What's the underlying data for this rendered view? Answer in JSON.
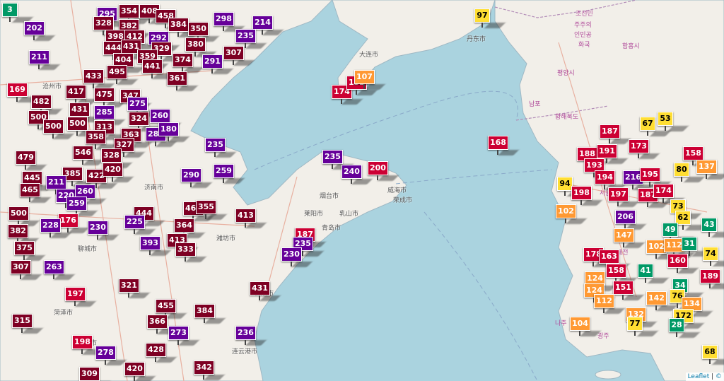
{
  "colors": {
    "sea": "#aad3df",
    "land": "#f2efe9",
    "good": "#009966",
    "moderate": "#ffde33",
    "sensitive": "#ff9933",
    "unhealthy": "#cc0033",
    "very_unhealthy": "#660099",
    "hazardous": "#7e0023"
  },
  "attribution": {
    "leaflet": "Leaflet",
    "separator": " | ",
    "copy": "©"
  },
  "places": [
    {
      "name": "조선민"
    },
    {
      "name": "주주의"
    },
    {
      "name": "인민공"
    },
    {
      "name": "화국"
    },
    {
      "name": "함흥시"
    },
    {
      "name": "평양시"
    },
    {
      "name": "남포"
    },
    {
      "name": "황해북도"
    },
    {
      "name": "서울"
    },
    {
      "name": "대전"
    },
    {
      "name": "광주"
    },
    {
      "name": "나주"
    },
    {
      "name": "丹东市"
    },
    {
      "name": "大连市"
    },
    {
      "name": "烟台市"
    },
    {
      "name": "威海市"
    },
    {
      "name": "青岛市"
    },
    {
      "name": "乳山市"
    },
    {
      "name": "莱阳市"
    },
    {
      "name": "荣成市"
    },
    {
      "name": "日照市"
    },
    {
      "name": "连云港市"
    },
    {
      "name": "济南市"
    },
    {
      "name": "潍坊市"
    },
    {
      "name": "沧州市"
    },
    {
      "name": "聊城市"
    },
    {
      "name": "商丘市"
    },
    {
      "name": "菏泽市"
    }
  ],
  "stations": [
    {
      "aqi": "3",
      "level": "good"
    },
    {
      "aqi": "202",
      "level": "very_unhealthy"
    },
    {
      "aqi": "295",
      "level": "very_unhealthy"
    },
    {
      "aqi": "354",
      "level": "hazardous"
    },
    {
      "aqi": "408",
      "level": "hazardous"
    },
    {
      "aqi": "458",
      "level": "hazardous"
    },
    {
      "aqi": "298",
      "level": "very_unhealthy"
    },
    {
      "aqi": "214",
      "level": "very_unhealthy"
    },
    {
      "aqi": "235",
      "level": "very_unhealthy"
    },
    {
      "aqi": "97",
      "level": "moderate"
    },
    {
      "aqi": "328",
      "level": "hazardous"
    },
    {
      "aqi": "382",
      "level": "hazardous"
    },
    {
      "aqi": "398",
      "level": "hazardous"
    },
    {
      "aqi": "412",
      "level": "hazardous"
    },
    {
      "aqi": "292",
      "level": "very_unhealthy"
    },
    {
      "aqi": "384",
      "level": "hazardous"
    },
    {
      "aqi": "350",
      "level": "hazardous"
    },
    {
      "aqi": "380",
      "level": "hazardous"
    },
    {
      "aqi": "307",
      "level": "hazardous"
    },
    {
      "aqi": "291",
      "level": "very_unhealthy"
    },
    {
      "aqi": "211",
      "level": "very_unhealthy"
    },
    {
      "aqi": "444",
      "level": "hazardous"
    },
    {
      "aqi": "431",
      "level": "hazardous"
    },
    {
      "aqi": "329",
      "level": "hazardous"
    },
    {
      "aqi": "404",
      "level": "hazardous"
    },
    {
      "aqi": "359",
      "level": "hazardous"
    },
    {
      "aqi": "495",
      "level": "hazardous"
    },
    {
      "aqi": "441",
      "level": "hazardous"
    },
    {
      "aqi": "374",
      "level": "hazardous"
    },
    {
      "aqi": "433",
      "level": "hazardous"
    },
    {
      "aqi": "361",
      "level": "hazardous"
    },
    {
      "aqi": "169",
      "level": "unhealthy"
    },
    {
      "aqi": "417",
      "level": "hazardous"
    },
    {
      "aqi": "475",
      "level": "hazardous"
    },
    {
      "aqi": "347",
      "level": "hazardous"
    },
    {
      "aqi": "275",
      "level": "very_unhealthy"
    },
    {
      "aqi": "482",
      "level": "hazardous"
    },
    {
      "aqi": "431",
      "level": "hazardous"
    },
    {
      "aqi": "285",
      "level": "very_unhealthy"
    },
    {
      "aqi": "324",
      "level": "hazardous"
    },
    {
      "aqi": "260",
      "level": "very_unhealthy"
    },
    {
      "aqi": "500",
      "level": "hazardous"
    },
    {
      "aqi": "500",
      "level": "hazardous"
    },
    {
      "aqi": "500",
      "level": "hazardous"
    },
    {
      "aqi": "313",
      "level": "hazardous"
    },
    {
      "aqi": "363",
      "level": "hazardous"
    },
    {
      "aqi": "285",
      "level": "very_unhealthy"
    },
    {
      "aqi": "180",
      "level": "very_unhealthy"
    },
    {
      "aqi": "358",
      "level": "hazardous"
    },
    {
      "aqi": "327",
      "level": "hazardous"
    },
    {
      "aqi": "235",
      "level": "very_unhealthy"
    },
    {
      "aqi": "479",
      "level": "hazardous"
    },
    {
      "aqi": "546",
      "level": "hazardous"
    },
    {
      "aqi": "328",
      "level": "hazardous"
    },
    {
      "aqi": "385",
      "level": "hazardous"
    },
    {
      "aqi": "422",
      "level": "hazardous"
    },
    {
      "aqi": "420",
      "level": "hazardous"
    },
    {
      "aqi": "290",
      "level": "very_unhealthy"
    },
    {
      "aqi": "259",
      "level": "very_unhealthy"
    },
    {
      "aqi": "445",
      "level": "hazardous"
    },
    {
      "aqi": "211",
      "level": "very_unhealthy"
    },
    {
      "aqi": "465",
      "level": "hazardous"
    },
    {
      "aqi": "220",
      "level": "very_unhealthy"
    },
    {
      "aqi": "260",
      "level": "very_unhealthy"
    },
    {
      "aqi": "259",
      "level": "very_unhealthy"
    },
    {
      "aqi": "500",
      "level": "hazardous"
    },
    {
      "aqi": "176",
      "level": "unhealthy"
    },
    {
      "aqi": "444",
      "level": "hazardous"
    },
    {
      "aqi": "467",
      "level": "hazardous"
    },
    {
      "aqi": "355",
      "level": "hazardous"
    },
    {
      "aqi": "413",
      "level": "hazardous"
    },
    {
      "aqi": "382",
      "level": "hazardous"
    },
    {
      "aqi": "228",
      "level": "very_unhealthy"
    },
    {
      "aqi": "230",
      "level": "very_unhealthy"
    },
    {
      "aqi": "225",
      "level": "very_unhealthy"
    },
    {
      "aqi": "364",
      "level": "hazardous"
    },
    {
      "aqi": "375",
      "level": "hazardous"
    },
    {
      "aqi": "393",
      "level": "very_unhealthy"
    },
    {
      "aqi": "413",
      "level": "hazardous"
    },
    {
      "aqi": "333",
      "level": "hazardous"
    },
    {
      "aqi": "307",
      "level": "hazardous"
    },
    {
      "aqi": "263",
      "level": "very_unhealthy"
    },
    {
      "aqi": "321",
      "level": "hazardous"
    },
    {
      "aqi": "197",
      "level": "unhealthy"
    },
    {
      "aqi": "315",
      "level": "hazardous"
    },
    {
      "aqi": "455",
      "level": "hazardous"
    },
    {
      "aqi": "384",
      "level": "hazardous"
    },
    {
      "aqi": "366",
      "level": "hazardous"
    },
    {
      "aqi": "273",
      "level": "very_unhealthy"
    },
    {
      "aqi": "198",
      "level": "unhealthy"
    },
    {
      "aqi": "428",
      "level": "hazardous"
    },
    {
      "aqi": "278",
      "level": "very_unhealthy"
    },
    {
      "aqi": "309",
      "level": "hazardous"
    },
    {
      "aqi": "420",
      "level": "hazardous"
    },
    {
      "aqi": "342",
      "level": "hazardous"
    },
    {
      "aqi": "236",
      "level": "very_unhealthy"
    },
    {
      "aqi": "431",
      "level": "hazardous"
    },
    {
      "aqi": "187",
      "level": "unhealthy"
    },
    {
      "aqi": "235",
      "level": "very_unhealthy"
    },
    {
      "aqi": "230",
      "level": "very_unhealthy"
    },
    {
      "aqi": "235",
      "level": "very_unhealthy"
    },
    {
      "aqi": "240",
      "level": "very_unhealthy"
    },
    {
      "aqi": "200",
      "level": "unhealthy"
    },
    {
      "aqi": "174",
      "level": "unhealthy"
    },
    {
      "aqi": "152",
      "level": "unhealthy"
    },
    {
      "aqi": "107",
      "level": "sensitive"
    },
    {
      "aqi": "168",
      "level": "unhealthy"
    },
    {
      "aqi": "67",
      "level": "moderate"
    },
    {
      "aqi": "53",
      "level": "moderate"
    },
    {
      "aqi": "187",
      "level": "unhealthy"
    },
    {
      "aqi": "173",
      "level": "unhealthy"
    },
    {
      "aqi": "158",
      "level": "unhealthy"
    },
    {
      "aqi": "188",
      "level": "unhealthy"
    },
    {
      "aqi": "191",
      "level": "unhealthy"
    },
    {
      "aqi": "193",
      "level": "unhealthy"
    },
    {
      "aqi": "194",
      "level": "unhealthy"
    },
    {
      "aqi": "216",
      "level": "very_unhealthy"
    },
    {
      "aqi": "195",
      "level": "unhealthy"
    },
    {
      "aqi": "80",
      "level": "moderate"
    },
    {
      "aqi": "137",
      "level": "sensitive"
    },
    {
      "aqi": "94",
      "level": "moderate"
    },
    {
      "aqi": "198",
      "level": "unhealthy"
    },
    {
      "aqi": "197",
      "level": "unhealthy"
    },
    {
      "aqi": "187",
      "level": "unhealthy"
    },
    {
      "aqi": "174",
      "level": "unhealthy"
    },
    {
      "aqi": "102",
      "level": "sensitive"
    },
    {
      "aqi": "73",
      "level": "moderate"
    },
    {
      "aqi": "62",
      "level": "moderate"
    },
    {
      "aqi": "206",
      "level": "very_unhealthy"
    },
    {
      "aqi": "49",
      "level": "good"
    },
    {
      "aqi": "43",
      "level": "good"
    },
    {
      "aqi": "147",
      "level": "sensitive"
    },
    {
      "aqi": "102",
      "level": "sensitive"
    },
    {
      "aqi": "112",
      "level": "sensitive"
    },
    {
      "aqi": "31",
      "level": "good"
    },
    {
      "aqi": "74",
      "level": "moderate"
    },
    {
      "aqi": "178",
      "level": "unhealthy"
    },
    {
      "aqi": "163",
      "level": "unhealthy"
    },
    {
      "aqi": "158",
      "level": "unhealthy"
    },
    {
      "aqi": "160",
      "level": "unhealthy"
    },
    {
      "aqi": "189",
      "level": "unhealthy"
    },
    {
      "aqi": "41",
      "level": "good"
    },
    {
      "aqi": "124",
      "level": "sensitive"
    },
    {
      "aqi": "151",
      "level": "unhealthy"
    },
    {
      "aqi": "34",
      "level": "good"
    },
    {
      "aqi": "124",
      "level": "sensitive"
    },
    {
      "aqi": "112",
      "level": "sensitive"
    },
    {
      "aqi": "142",
      "level": "sensitive"
    },
    {
      "aqi": "76",
      "level": "moderate"
    },
    {
      "aqi": "134",
      "level": "sensitive"
    },
    {
      "aqi": "132",
      "level": "sensitive"
    },
    {
      "aqi": "172",
      "level": "moderate"
    },
    {
      "aqi": "104",
      "level": "sensitive"
    },
    {
      "aqi": "77",
      "level": "moderate"
    },
    {
      "aqi": "28",
      "level": "good"
    },
    {
      "aqi": "68",
      "level": "moderate"
    }
  ]
}
